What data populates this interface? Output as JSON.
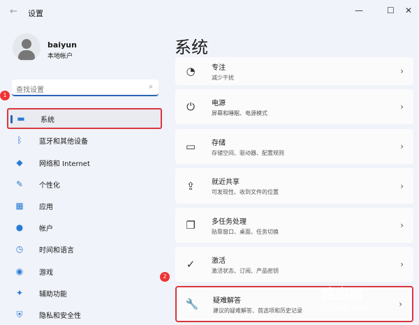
{
  "window": {
    "title": "设置",
    "back": "←",
    "min": "—",
    "max": "☐",
    "close": "✕"
  },
  "user": {
    "name": "baiyun",
    "type": "本地帐户"
  },
  "search": {
    "placeholder": "查找设置",
    "icon": "⌕"
  },
  "badges": [
    "1",
    "2"
  ],
  "sidebar": [
    {
      "label": "系统",
      "icon": "▬"
    },
    {
      "label": "蓝牙和其他设备",
      "icon": "ᛒ"
    },
    {
      "label": "网络和 Internet",
      "icon": "◆"
    },
    {
      "label": "个性化",
      "icon": "✎"
    },
    {
      "label": "应用",
      "icon": "▦"
    },
    {
      "label": "帐户",
      "icon": "●"
    },
    {
      "label": "时间和语言",
      "icon": "◷"
    },
    {
      "label": "游戏",
      "icon": "◉"
    },
    {
      "label": "辅助功能",
      "icon": "✦"
    },
    {
      "label": "隐私和安全性",
      "icon": "⛨"
    }
  ],
  "main": {
    "title": "系统",
    "cards": [
      {
        "title": "专注",
        "sub": "减少干扰",
        "icon": "◔"
      },
      {
        "title": "电源",
        "sub": "屏幕和睡眠、电源模式",
        "icon": "⏻"
      },
      {
        "title": "存储",
        "sub": "存储空间、驱动器、配置规则",
        "icon": "▭"
      },
      {
        "title": "就近共享",
        "sub": "可发现性、收到文件的位置",
        "icon": "⇪"
      },
      {
        "title": "多任务处理",
        "sub": "贴靠窗口、桌面、任务切换",
        "icon": "❐"
      },
      {
        "title": "激活",
        "sub": "激活状态、订阅、产品密钥",
        "icon": "✓"
      },
      {
        "title": "疑难解答",
        "sub": "建议的疑难解答、首选项和历史记录",
        "icon": "🔧"
      }
    ]
  },
  "watermark": {
    "title": "路由器",
    "url": "luyouqi.com"
  }
}
